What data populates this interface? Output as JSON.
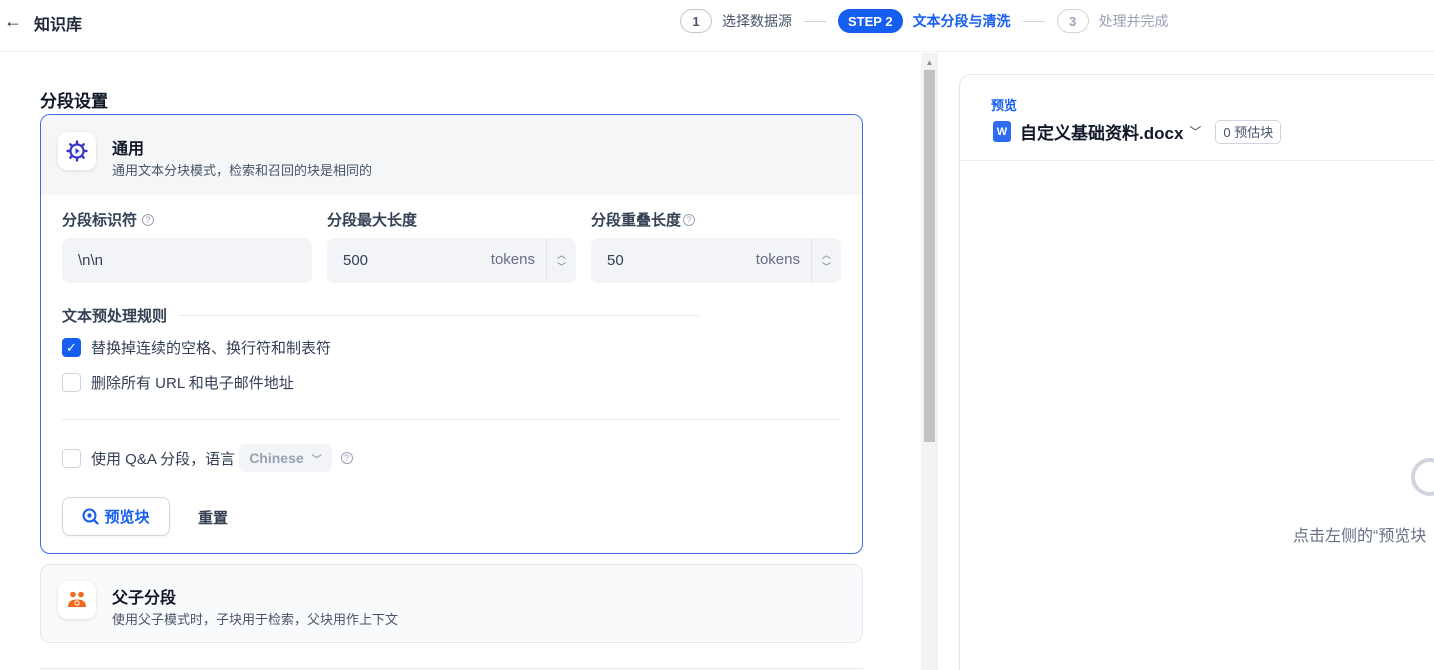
{
  "header": {
    "back_icon": "arrow-left-icon",
    "title": "知识库",
    "steps": [
      {
        "num": "1",
        "label": "选择数据源",
        "state": "done"
      },
      {
        "num": "STEP 2",
        "label": "文本分段与清洗",
        "state": "active"
      },
      {
        "num": "3",
        "label": "处理并完成",
        "state": "pending"
      }
    ]
  },
  "segment_settings": {
    "title": "分段设置",
    "general": {
      "icon": "gear-icon",
      "title": "通用",
      "description": "通用文本分块模式，检索和召回的块是相同的",
      "delimiter": {
        "label": "分段标识符",
        "value": "\\n\\n"
      },
      "max_length": {
        "label": "分段最大长度",
        "value": "500",
        "unit": "tokens"
      },
      "overlap": {
        "label": "分段重叠长度",
        "value": "50",
        "unit": "tokens"
      },
      "rules_title": "文本预处理规则",
      "rules": [
        {
          "label": "替换掉连续的空格、换行符和制表符",
          "checked": true
        },
        {
          "label": "删除所有 URL 和电子邮件地址",
          "checked": false
        }
      ],
      "qa": {
        "label": "使用 Q&A 分段，语言",
        "checked": false,
        "language": "Chinese"
      },
      "preview_button": "预览块",
      "reset_button": "重置"
    },
    "parent_child": {
      "icon": "parent-child-icon",
      "title": "父子分段",
      "description": "使用父子模式时，子块用于检索，父块用作上下文"
    }
  },
  "preview": {
    "tag": "预览",
    "file_name": "自定义基础资料.docx",
    "estimate": "0 预估块",
    "empty_hint": "点击左侧的“预览块"
  },
  "colors": {
    "accent": "#155eef",
    "border_active": "#3b6fe0",
    "orange_icon": "#f06a1d"
  }
}
